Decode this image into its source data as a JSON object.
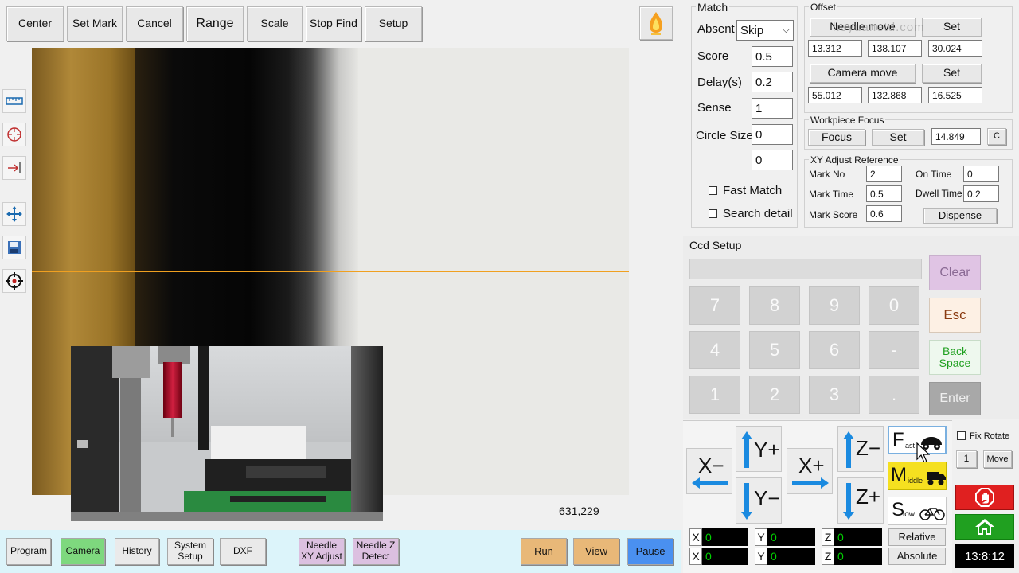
{
  "toolbar": {
    "center": "Center",
    "set_mark": "Set Mark",
    "cancel": "Cancel",
    "range": "Range",
    "scale": "Scale",
    "stop_find": "Stop Find",
    "setup": "Setup"
  },
  "camera": {
    "cursor_coords": "631,229"
  },
  "watermark": "hoyuanetd.com",
  "match": {
    "title": "Match",
    "absent_label": "Absent",
    "absent_value": "Skip",
    "score_label": "Score",
    "score_value": "0.5",
    "delay_label": "Delay(s)",
    "delay_value": "0.2",
    "sense_label": "Sense",
    "sense_value": "1",
    "circle_size_label": "Circle Size",
    "circle_size_value_1": "0",
    "circle_size_value_2": "0",
    "fast_match_label": "Fast Match",
    "search_detail_label": "Search detail"
  },
  "offset": {
    "title": "Offset",
    "needle_move": "Needle move",
    "set1": "Set",
    "needle_x": "13.312",
    "needle_y": "138.107",
    "needle_z": "30.024",
    "camera_move": "Camera move",
    "set2": "Set",
    "camera_x": "55.012",
    "camera_y": "132.868",
    "camera_z": "16.525"
  },
  "workpiece_focus": {
    "title": "Workpiece Focus",
    "focus": "Focus",
    "set": "Set",
    "value": "14.849",
    "c": "C"
  },
  "xy_adjust": {
    "title": "XY Adjust Reference",
    "mark_no_label": "Mark No",
    "mark_no_value": "2",
    "on_time_label": "On Time",
    "on_time_value": "0",
    "mark_time_label": "Mark Time",
    "mark_time_value": "0.5",
    "dwell_time_label": "Dwell Time",
    "dwell_time_value": "0.2",
    "mark_score_label": "Mark Score",
    "mark_score_value": "0.6",
    "dispense": "Dispense"
  },
  "ccd": {
    "tab_label": "Ccd Setup",
    "keys_row1": [
      "7",
      "8",
      "9",
      "0"
    ],
    "keys_row2": [
      "4",
      "5",
      "6",
      "-"
    ],
    "keys_row3": [
      "1",
      "2",
      "3",
      "."
    ],
    "clear": "Clear",
    "esc": "Esc",
    "back_space": "Back Space",
    "enter": "Enter"
  },
  "jog": {
    "x_minus": "X−",
    "x_plus": "X+",
    "y_plus": "Y+",
    "y_minus": "Y−",
    "z_minus": "Z−",
    "z_plus": "Z+",
    "fast_letter": "F",
    "fast_sub": "ast",
    "middle_letter": "M",
    "middle_sub": "iddle",
    "slow_letter": "S",
    "slow_sub": "low",
    "fix_rotate": "Fix Rotate",
    "rotate_value": "1",
    "move": "Move"
  },
  "coords": {
    "rel": {
      "x_label": "X",
      "x": "0",
      "y_label": "Y",
      "y": "0",
      "z_label": "Z",
      "z": "0",
      "mode": "Relative"
    },
    "abs": {
      "x_label": "X",
      "x": "0",
      "y_label": "Y",
      "y": "0",
      "z_label": "Z",
      "z": "0",
      "mode": "Absolute"
    }
  },
  "clock": "13:8:12",
  "bottom": {
    "program": "Program",
    "camera": "Camera",
    "history": "History",
    "system_setup": "System Setup",
    "dxf": "DXF",
    "needle_xy_adjust": "Needle XY Adjust",
    "needle_z_detect": "Needle Z Detect",
    "run": "Run",
    "view": "View",
    "pause": "Pause"
  },
  "colors": {
    "crosshair": "#f0a020",
    "coord_text": "#00d000",
    "camera_active": "#7ed87e",
    "needle_purple": "#dcc0e0",
    "run_orange": "#e8b878",
    "pause_blue": "#4a90f0",
    "stop_red": "#e02020",
    "home_green": "#20a020",
    "middle_yellow": "#f5e020"
  }
}
